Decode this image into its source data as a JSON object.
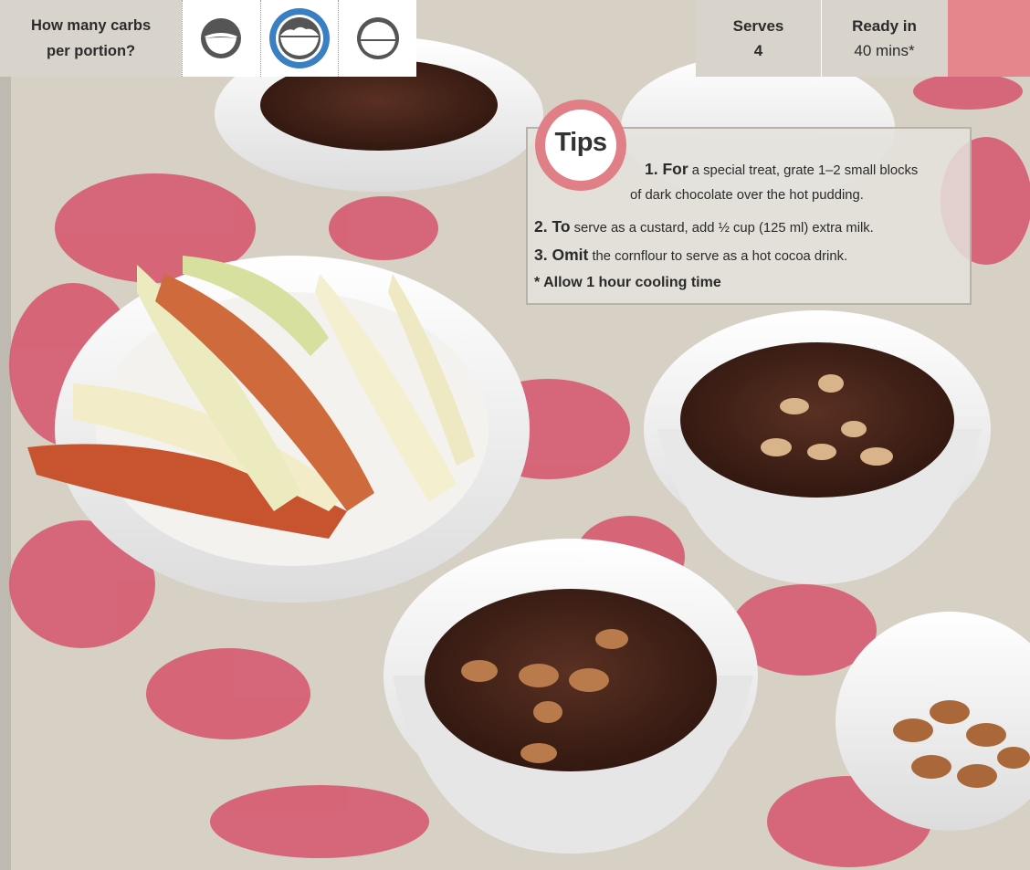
{
  "carbs": {
    "label_line1": "How many carbs",
    "label_line2": "per portion?",
    "options": [
      "low-carb-bowl-icon",
      "medium-carb-bowl-icon",
      "high-carb-bowl-icon"
    ],
    "selected_index": 1
  },
  "info": {
    "serves_label": "Serves",
    "serves_value": "4",
    "ready_label": "Ready in",
    "ready_value": "40 mins*"
  },
  "tips": {
    "badge": "Tips",
    "tip1_lead": "1. For",
    "tip1_text": " a special treat, grate 1–2 small blocks",
    "tip1_cont": "of dark chocolate over the hot pudding.",
    "tip2_lead": "2. To",
    "tip2_text": " serve as a custard, add ½ cup (125 ml) extra milk.",
    "tip3_lead": "3. Omit",
    "tip3_text": " the cornflour to serve as a hot cocoa drink.",
    "note": "* Allow 1 hour cooling time"
  },
  "colors": {
    "accent_blue": "#3a7fc4",
    "tips_pink": "#e07f86",
    "chocolate": "#3b1f16",
    "pink_pattern": "#d9596f"
  }
}
